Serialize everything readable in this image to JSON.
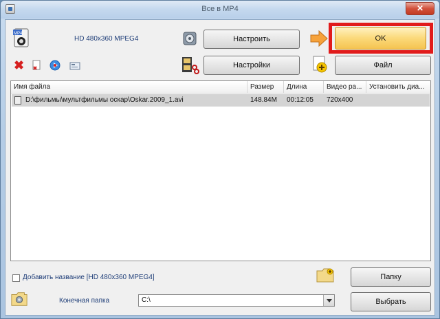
{
  "window": {
    "title": "Все в MP4",
    "close_glyph": "✕"
  },
  "profile": {
    "label": "HD 480x360 MPEG4"
  },
  "buttons": {
    "configure": "Настроить",
    "settings": "Настройки",
    "ok": "OK",
    "file": "Файл",
    "folder": "Папку",
    "choose": "Выбрать"
  },
  "toolbar": {
    "delete_glyph": "✖"
  },
  "filelist": {
    "columns": [
      "Имя файла",
      "Размер",
      "Длина",
      "Видео ра...",
      "Установить диа..."
    ],
    "rows": [
      {
        "name": "D:\\фильмы\\мультфильмы оскар\\Oskar.2009_1.avi",
        "size": "148.84M",
        "length": "00:12:05",
        "video": "720x400",
        "range": ""
      }
    ]
  },
  "bottom": {
    "add_title_label": "Добавить название [HD 480x360 MPEG4]",
    "dest_label": "Конечная папка",
    "dest_path": "C:\\"
  },
  "colors": {
    "accent_highlight": "#e11b1b",
    "ok_button": "#fbd97a",
    "label_blue": "#1f3e78"
  }
}
